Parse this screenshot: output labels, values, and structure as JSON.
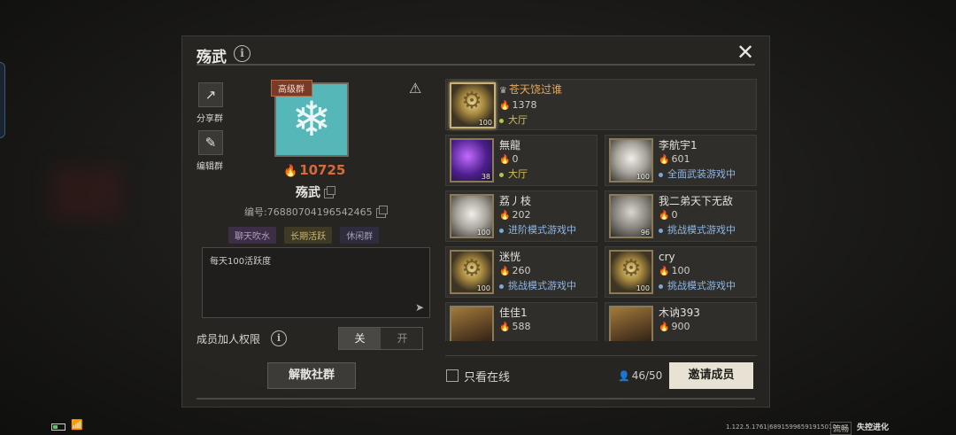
{
  "dialog": {
    "title": "殇武",
    "close_glyph": "✕"
  },
  "sidebar": {
    "share_label": "分享群",
    "edit_label": "编辑群"
  },
  "group": {
    "tier_badge": "高级群",
    "heat": "10725",
    "name": "殇武",
    "id_text": "编号:76880704196542465",
    "tags": [
      "聊天吹水",
      "长期活跃",
      "休闲群"
    ],
    "notice": "每天100活跃度"
  },
  "permissions": {
    "label": "成员加人权限",
    "off_label": "关",
    "on_label": "开",
    "selected": "关"
  },
  "actions": {
    "dissolve_label": "解散社群",
    "online_only_label": "只看在线",
    "member_count": "46/50",
    "invite_label": "邀请成员"
  },
  "members": [
    {
      "name": "苍天饶过谁",
      "score": "1378",
      "status": "大厅",
      "status_color": "#d4c04a",
      "level": "100",
      "avatar": "gold",
      "leader": true
    },
    {
      "name": "無龍",
      "score": "0",
      "status": "大厅",
      "status_color": "#d4c04a",
      "level": "38",
      "avatar": "purple",
      "leader": false
    },
    {
      "name": "李航宇1",
      "score": "601",
      "status": "全面武装游戏中",
      "status_color": "#8fb6e6",
      "level": "100",
      "avatar": "light",
      "leader": false
    },
    {
      "name": "荔丿枝",
      "score": "202",
      "status": "进阶模式游戏中",
      "status_color": "#8fb6e6",
      "level": "100",
      "avatar": "light",
      "leader": false
    },
    {
      "name": "我二弟天下无敌",
      "score": "0",
      "status": "挑战模式游戏中",
      "status_color": "#8fb6e6",
      "level": "96",
      "avatar": "gray",
      "leader": false
    },
    {
      "name": "迷恍",
      "score": "260",
      "status": "挑战模式游戏中",
      "status_color": "#8fb6e6",
      "level": "100",
      "avatar": "gold",
      "leader": false
    },
    {
      "name": "cry",
      "score": "100",
      "status": "挑战模式游戏中",
      "status_color": "#8fb6e6",
      "level": "100",
      "avatar": "gold",
      "leader": false
    },
    {
      "name": "佳佳1",
      "score": "588",
      "status": "",
      "status_color": "#8fb6e6",
      "level": "",
      "avatar": "mech",
      "leader": false
    },
    {
      "name": "木讷393",
      "score": "900",
      "status": "",
      "status_color": "#8fb6e6",
      "level": "",
      "avatar": "mech",
      "leader": false
    }
  ],
  "footer": {
    "version": "1.122.5.1761|68915996591915010",
    "network": "流畅",
    "brand": "失控进化"
  },
  "icons": {
    "share": "share-icon",
    "edit": "edit-icon",
    "warning": "warning-icon",
    "info": "info-icon",
    "fire": "fire-icon",
    "copy": "copy-icon",
    "send": "send-icon",
    "crown": "crown-icon",
    "person": "person-icon",
    "battery": "battery-icon",
    "wifi": "wifi-icon"
  }
}
